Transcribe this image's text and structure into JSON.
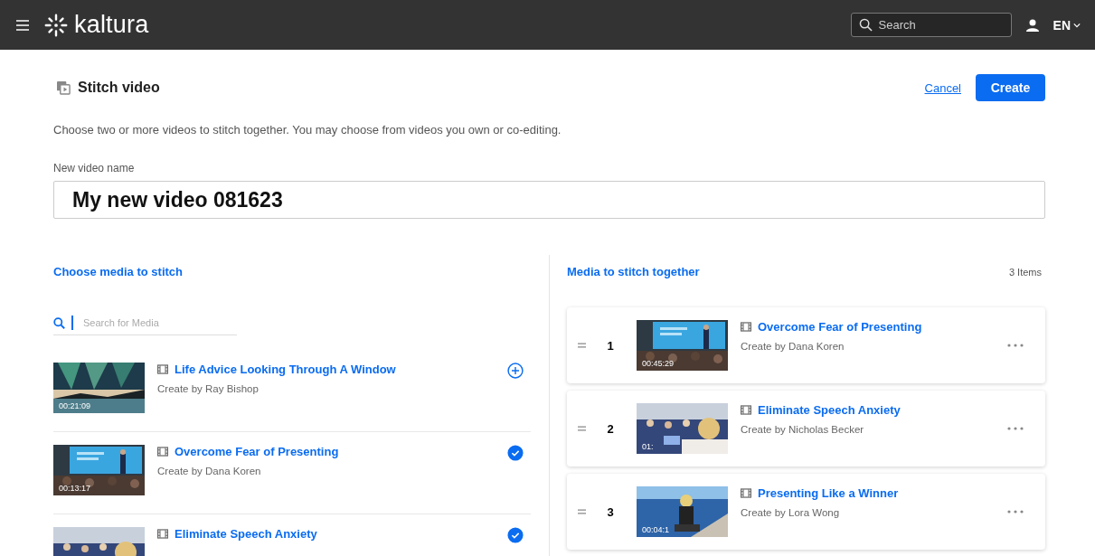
{
  "header": {
    "logo": "kaltura",
    "search": {
      "placeholder": "Search"
    },
    "language": "EN"
  },
  "page": {
    "title": "Stitch video",
    "cancel": "Cancel",
    "create": "Create",
    "description": "Choose two or more videos to stitch together. You may choose from videos you own or co-editing.",
    "name_label": "New video name",
    "name_value": "My new video 081623"
  },
  "choose": {
    "heading": "Choose media to stitch",
    "search": {
      "placeholder": "Search for Media"
    },
    "items": [
      {
        "title": "Life Advice Looking Through A Window",
        "creator": "Create by Ray Bishop",
        "duration": "00:21:09",
        "selected": false
      },
      {
        "title": "Overcome Fear of Presenting",
        "creator": "Create by Dana Koren",
        "duration": "00:13:17",
        "selected": true
      },
      {
        "title": "Eliminate Speech Anxiety",
        "selected": true
      }
    ]
  },
  "stitch": {
    "heading": "Media to stitch together",
    "count": "3 Items",
    "items": [
      {
        "index": "1",
        "title": "Overcome Fear of Presenting",
        "creator": "Create by Dana Koren",
        "duration": "00:45:29"
      },
      {
        "index": "2",
        "title": "Eliminate Speech Anxiety",
        "creator": "Create by Nicholas Becker",
        "duration": "01:"
      },
      {
        "index": "3",
        "title": "Presenting Like a Winner",
        "creator": "Create by Lora Wong",
        "duration": "00:04:1"
      }
    ]
  }
}
